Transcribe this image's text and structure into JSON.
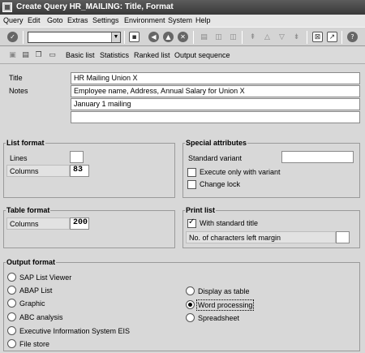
{
  "window": {
    "title": "Create Query HR_MAILING: Title, Format"
  },
  "menu": [
    "Query",
    "Edit",
    "Goto",
    "Extras",
    "Settings",
    "Environment",
    "System",
    "Help"
  ],
  "command_field": {
    "value": ""
  },
  "app_toolbar": {
    "basic_list": "Basic list",
    "statistics": "Statistics",
    "ranked_list": "Ranked list",
    "output_sequence": "Output sequence"
  },
  "header": {
    "title_label": "Title",
    "title_value": "HR Mailing Union X",
    "notes_label": "Notes",
    "notes": [
      "Employee name, Address, Annual Salary for Union X",
      "January 1 mailing",
      ""
    ]
  },
  "list_format": {
    "title": "List format",
    "lines_label": "Lines",
    "lines_value": "",
    "columns_label": "Columns",
    "columns_value": "83"
  },
  "special_attributes": {
    "title": "Special attributes",
    "standard_variant_label": "Standard variant",
    "standard_variant_value": "",
    "execute_only_label": "Execute only with variant",
    "execute_only_checked": false,
    "change_lock_label": "Change lock",
    "change_lock_checked": false
  },
  "table_format": {
    "title": "Table format",
    "columns_label": "Columns",
    "columns_value": "200"
  },
  "print_list": {
    "title": "Print list",
    "with_standard_title_label": "With standard title",
    "with_standard_title_checked": true,
    "left_margin_label": "No. of characters left margin",
    "left_margin_value": ""
  },
  "output_format": {
    "title": "Output format",
    "options_left": [
      "SAP List Viewer",
      "ABAP List",
      "Graphic",
      "ABC analysis",
      "Executive Information System EIS",
      "File store"
    ],
    "options_right": [
      "Display as table",
      "Word processing",
      "Spreadsheet"
    ],
    "selected": "Word processing"
  }
}
